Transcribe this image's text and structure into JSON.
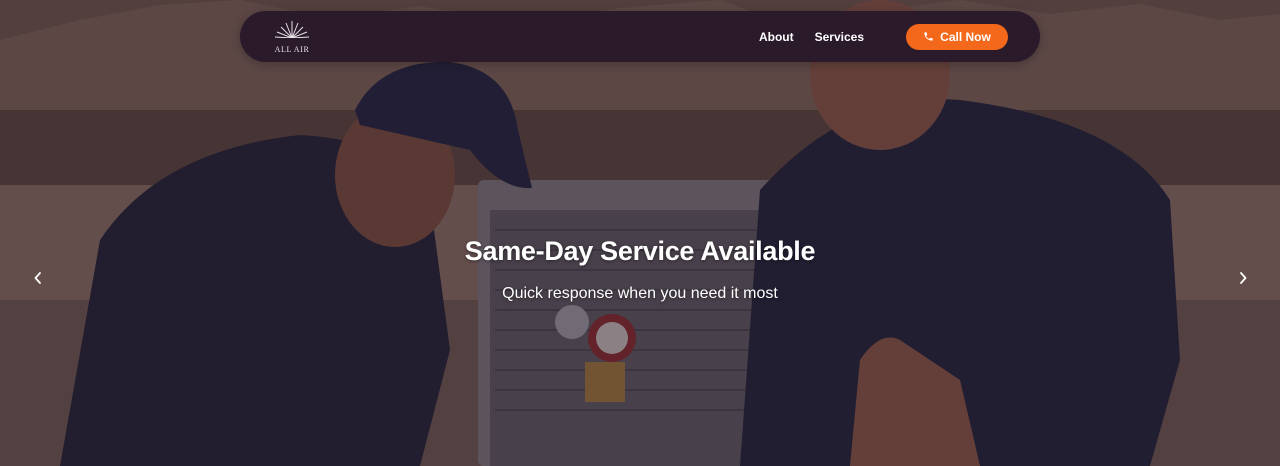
{
  "brand": {
    "logo_text": "ALL AIR"
  },
  "nav": {
    "links": [
      {
        "label": "About"
      },
      {
        "label": "Services"
      }
    ],
    "cta_label": "Call Now",
    "cta_icon": "phone-icon",
    "cta_color": "#f4681c",
    "bar_color": "#2a1a2a"
  },
  "hero": {
    "headline": "Same-Day Service Available",
    "subheadline": "Quick response when you need it most",
    "image_description_icon": "hero-photo",
    "prev_icon": "chevron-left-icon",
    "next_icon": "chevron-right-icon"
  }
}
